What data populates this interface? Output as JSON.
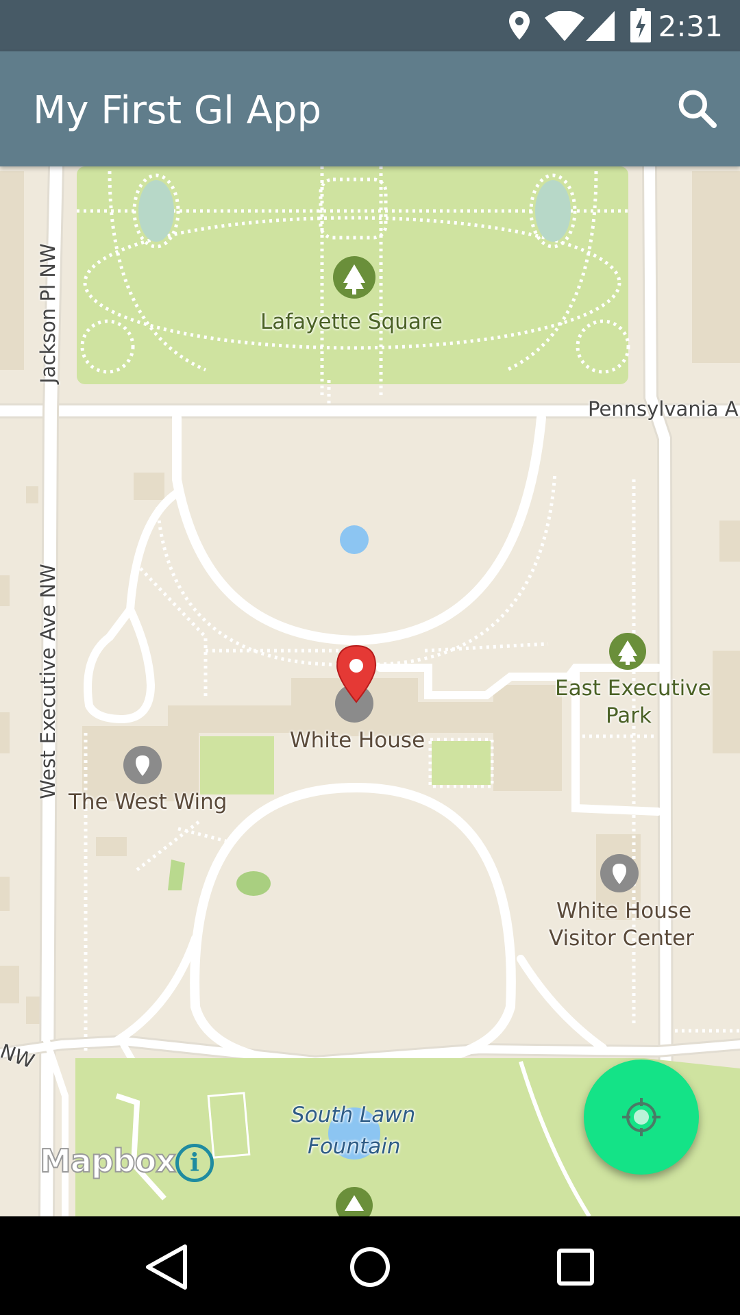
{
  "status_bar": {
    "time": "2:31",
    "icons": [
      "location-icon",
      "wifi-icon",
      "cell-signal-icon",
      "battery-charging-icon"
    ]
  },
  "app_bar": {
    "title": "My First Gl App",
    "search_icon": "search-icon"
  },
  "map": {
    "labels": {
      "lafayette": "Lafayette Square",
      "pennsylvania": "Pennsylvania A",
      "jackson": "Jackson Pl NW",
      "west_exec": "West Executive Ave NW",
      "nw_left": "NW",
      "white_house": "White House",
      "west_wing": "The West Wing",
      "east_exec_1": "East Executive",
      "east_exec_2": "Park",
      "visitor_1": "White House",
      "visitor_2": "Visitor Center",
      "fountain_1": "South Lawn",
      "fountain_2": "Fountain"
    },
    "colors": {
      "park": "#cfe3a0",
      "land": "#efe9dc",
      "road": "#ffffff",
      "water": "#8cc5f2",
      "building": "#e5dcc8",
      "marker": "#e53935"
    }
  },
  "attribution": {
    "logo": "Mapbox",
    "info": "i"
  },
  "fab": {
    "icon": "my-location-icon",
    "color": "#14e387"
  },
  "nav_bar": {
    "icons": [
      "back-icon",
      "home-icon",
      "recents-icon"
    ]
  }
}
